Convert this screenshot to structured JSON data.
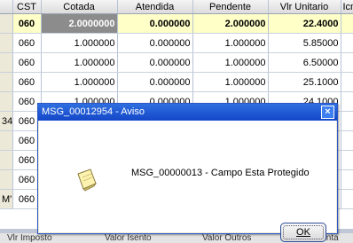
{
  "grid": {
    "headers": [
      "",
      "CST",
      "Cotada",
      "Atendida",
      "Pendente",
      "Vlr Unitario",
      "Icm"
    ],
    "rows": [
      {
        "left": "",
        "cst": "060",
        "cotada": "2.0000000",
        "atendida": "0.000000",
        "pendente": "2.000000",
        "vlr": "22.4000",
        "icm": ""
      },
      {
        "left": "",
        "cst": "060",
        "cotada": "1.000000",
        "atendida": "0.000000",
        "pendente": "1.000000",
        "vlr": "5.85000",
        "icm": ""
      },
      {
        "left": "",
        "cst": "060",
        "cotada": "1.000000",
        "atendida": "0.000000",
        "pendente": "1.000000",
        "vlr": "6.50000",
        "icm": ""
      },
      {
        "left": "",
        "cst": "060",
        "cotada": "1.000000",
        "atendida": "0.000000",
        "pendente": "1.000000",
        "vlr": "25.1000",
        "icm": ""
      },
      {
        "left": "",
        "cst": "060",
        "cotada": "1.000000",
        "atendida": "0.000000",
        "pendente": "1.000000",
        "vlr": "24.1000",
        "icm": ""
      },
      {
        "left": "34",
        "cst": "060",
        "cotada": "",
        "atendida": "",
        "pendente": "",
        "vlr": "",
        "icm": ""
      },
      {
        "left": "",
        "cst": "060",
        "cotada": "",
        "atendida": "",
        "pendente": "",
        "vlr": "",
        "icm": ""
      },
      {
        "left": "",
        "cst": "060",
        "cotada": "",
        "atendida": "",
        "pendente": "",
        "vlr": "",
        "icm": ""
      },
      {
        "left": "",
        "cst": "060",
        "cotada": "",
        "atendida": "",
        "pendente": "",
        "vlr": "",
        "icm": ""
      },
      {
        "left": "M'",
        "cst": "060",
        "cotada": "",
        "atendida": "",
        "pendente": "",
        "vlr": "",
        "icm": ""
      }
    ]
  },
  "footer": {
    "labels": [
      "Vlr Imposto",
      "Valor Isento",
      "Valor Outros",
      "Vlr Conta"
    ]
  },
  "dialog": {
    "title": "MSG_00012954 - Aviso",
    "close_label": "×",
    "message": "MSG_00000013 - Campo Esta Protegido",
    "ok_label": "OK",
    "icon": "note-icon"
  }
}
